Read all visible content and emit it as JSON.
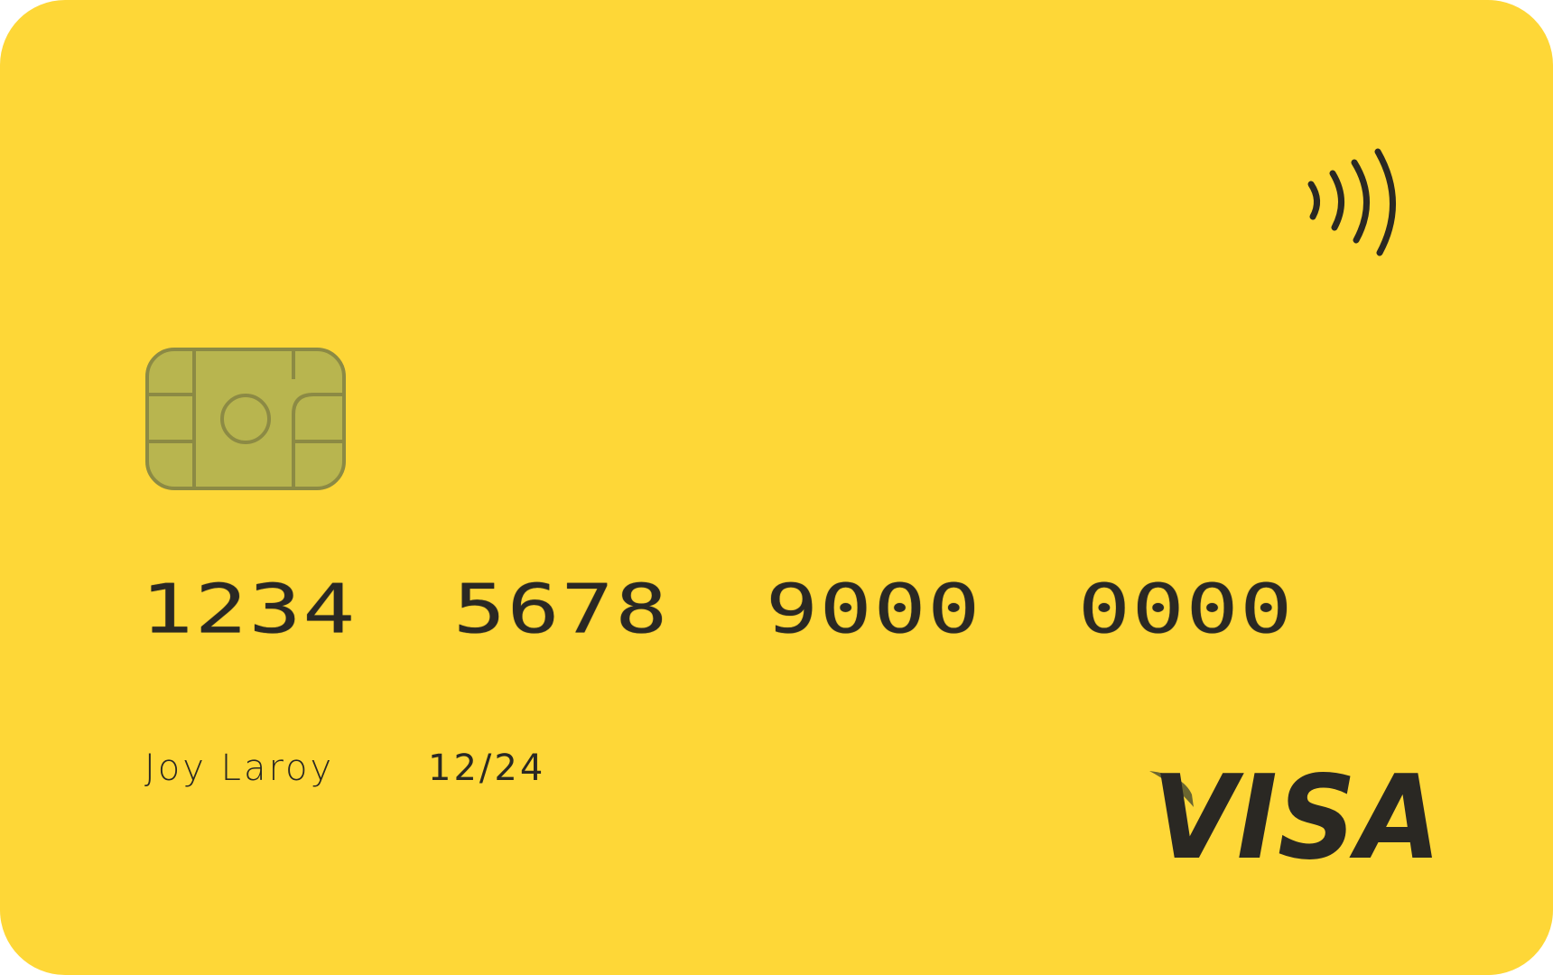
{
  "card": {
    "background_color": "#FED737",
    "ink_color": "#2A2823",
    "chip_color": "#B8B54F",
    "contactless_icon": "contactless-icon",
    "chip_icon": "chip-icon",
    "number_groups": [
      "1234",
      "5678",
      "9000",
      "0000"
    ],
    "holder_name": "Joy Laroy",
    "expiry": "12/24",
    "brand": "VISA"
  }
}
